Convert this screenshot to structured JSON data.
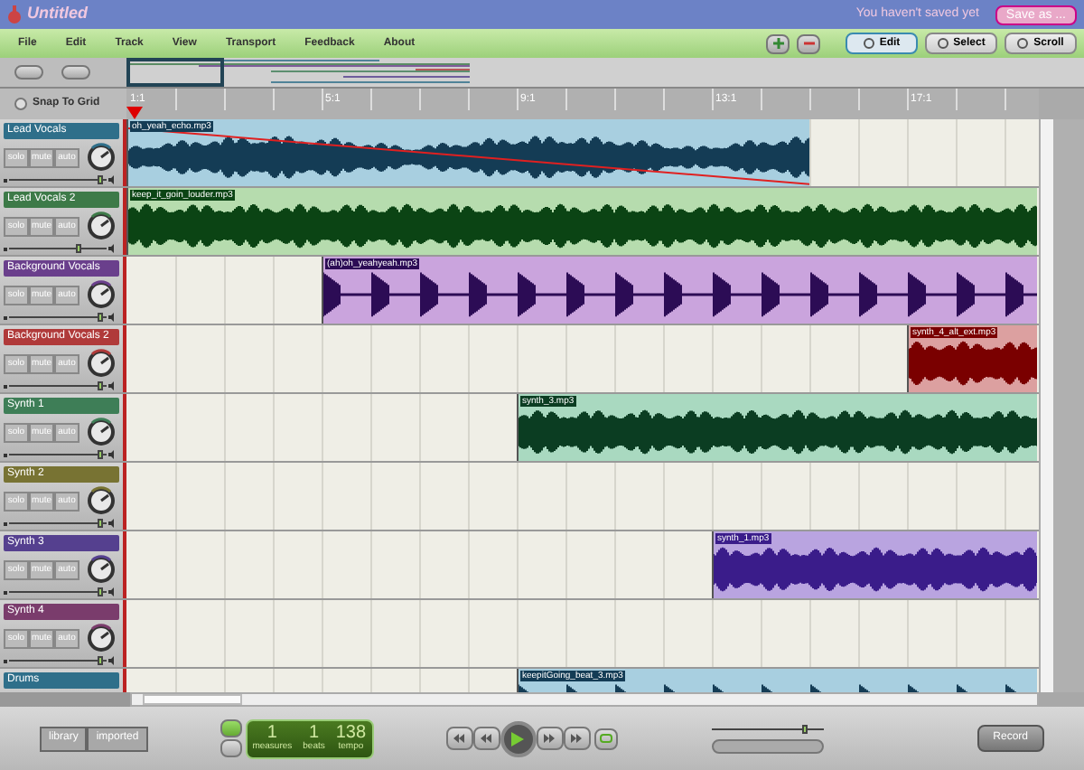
{
  "window": {
    "title": "Untitled",
    "save_status": "You haven't saved yet",
    "save_button": "Save as ..."
  },
  "menu": [
    "File",
    "Edit",
    "Track",
    "View",
    "Transport",
    "Feedback",
    "About"
  ],
  "tools": [
    {
      "label": "Edit",
      "selected": true
    },
    {
      "label": "Select",
      "selected": false
    },
    {
      "label": "Scroll",
      "selected": false
    }
  ],
  "snap_to_grid": {
    "label": "Snap To Grid",
    "checked": false
  },
  "ruler": [
    "1:1",
    "5:1",
    "9:1",
    "13:1",
    "17:1"
  ],
  "tracks": [
    {
      "name": "Lead Vocals",
      "color": "#2f6f8a",
      "buttons": [
        "solo",
        "mute",
        "auto"
      ],
      "level": 0.95,
      "clip": {
        "name": "oh_yeah_echo.mp3",
        "envelope": true
      }
    },
    {
      "name": "Lead Vocals 2",
      "color": "#3d7a48",
      "buttons": [
        "solo",
        "mute",
        "auto"
      ],
      "level": 0.72,
      "clip": {
        "name": "keep_it_goin_louder.mp3",
        "envelope": false
      }
    },
    {
      "name": "Background Vocals",
      "color": "#6a3f8c",
      "buttons": [
        "solo",
        "mute",
        "auto"
      ],
      "level": 0.95,
      "clip": {
        "name": "(ah)oh_yeahyeah.mp3",
        "envelope": false
      }
    },
    {
      "name": "Background Vocals 2",
      "color": "#b03a3a",
      "buttons": [
        "solo",
        "mute",
        "auto"
      ],
      "level": 0.95,
      "clip": {
        "name": "synth_4_alt_ext.mp3",
        "envelope": false
      }
    },
    {
      "name": "Synth 1",
      "color": "#3e7e57",
      "buttons": [
        "solo",
        "mute",
        "auto"
      ],
      "level": 0.95,
      "clip": {
        "name": "synth_3.mp3",
        "envelope": false
      }
    },
    {
      "name": "Synth 2",
      "color": "#787333",
      "buttons": [
        "solo",
        "mute",
        "auto"
      ],
      "level": 0.95
    },
    {
      "name": "Synth 3",
      "color": "#55408f",
      "buttons": [
        "solo",
        "mute",
        "auto"
      ],
      "level": 0.95,
      "clip": {
        "name": "synth_1.mp3",
        "envelope": false
      }
    },
    {
      "name": "Synth 4",
      "color": "#7a3c6c",
      "buttons": [
        "solo",
        "mute",
        "auto"
      ],
      "level": 0.95
    },
    {
      "name": "Drums",
      "color": "#2f6f8a",
      "clip": {
        "name": "keepitGoing_beat_3.mp3",
        "envelope": false
      }
    }
  ],
  "library_tabs": [
    {
      "label": "library",
      "selected": false
    },
    {
      "label": "imported",
      "selected": false
    }
  ],
  "counter": [
    {
      "value": "1",
      "label": "measures"
    },
    {
      "value": "1",
      "label": "beats"
    },
    {
      "value": "138",
      "label": "tempo"
    }
  ],
  "master_volume": {
    "level": 0.85
  },
  "record_button": "Record"
}
